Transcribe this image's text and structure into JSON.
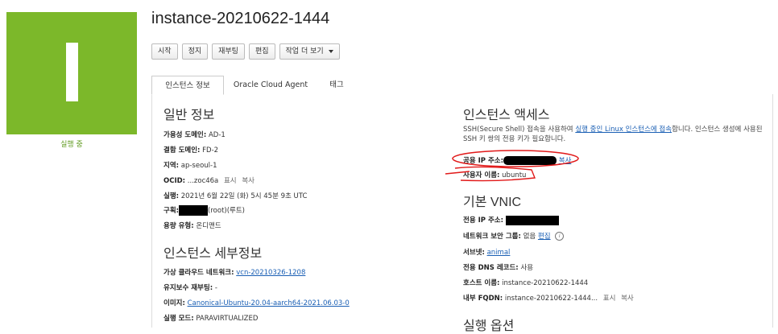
{
  "status": {
    "label": "실행 중"
  },
  "instance": {
    "title": "instance-20210622-1444"
  },
  "actions": {
    "start": "시작",
    "stop": "정지",
    "reboot": "재부팅",
    "edit": "편집",
    "more": "작업 더 보기"
  },
  "tabs": [
    "인스턴스 정보",
    "Oracle Cloud Agent",
    "태그"
  ],
  "general": {
    "heading": "일반 정보",
    "availability_domain": {
      "label": "가용성 도메인:",
      "value": "AD-1"
    },
    "fault_domain": {
      "label": "결함 도메인:",
      "value": "FD-2"
    },
    "region": {
      "label": "지역:",
      "value": "ap-seoul-1"
    },
    "ocid": {
      "label": "OCID:",
      "value": "...zoc46a",
      "show": "표시",
      "copy": "복사"
    },
    "launched": {
      "label": "실행:",
      "value": "2021년 6월 22일 (화) 5시 45분 9초 UTC"
    },
    "compartment": {
      "label": "구획:",
      "value": "(root)(루트)"
    },
    "capacity_type": {
      "label": "용량 유형:",
      "value": "온디맨드"
    }
  },
  "details": {
    "heading": "인스턴스 세부정보",
    "vcn": {
      "label": "가상 클라우드 네트워크:",
      "value": "vcn-20210326-1208"
    },
    "maintenance": {
      "label": "유지보수 재부팅:",
      "value": "-"
    },
    "image": {
      "label": "이미지:",
      "value": "Canonical-Ubuntu-20.04-aarch64-2021.06.03-0"
    },
    "launch_mode": {
      "label": "실행 모드:",
      "value": "PARAVIRTUALIZED"
    }
  },
  "access": {
    "heading": "인스턴스 액세스",
    "desc_before": "SSH(Secure Shell) 접속을 사용하여 ",
    "desc_link": "실행 중인 Linux 인스턴스에 접속",
    "desc_after": "합니다. 인스턴스 생성에 사용된 SSH 키 쌍의 전용 키가 필요합니다.",
    "public_ip": {
      "label": "공용 IP 주소:",
      "copy": "복사"
    },
    "username": {
      "label": "사용자 이름:",
      "value": "ubuntu"
    }
  },
  "vnic": {
    "heading": "기본 VNIC",
    "private_ip": {
      "label": "전용 IP 주소:"
    },
    "nsg": {
      "label": "네트워크 보안 그룹:",
      "value": "없음",
      "edit": "편집",
      "info_icon": "info-icon"
    },
    "subnet": {
      "label": "서브넷:",
      "value": "animal"
    },
    "private_dns": {
      "label": "전용 DNS 레코드:",
      "value": "사용"
    },
    "hostname": {
      "label": "호스트 이름:",
      "value": "instance-20210622-1444"
    },
    "fqdn": {
      "label": "내부 FQDN:",
      "value": "instance-20210622-1444...",
      "show": "표시",
      "copy": "복사"
    }
  },
  "launch_options": {
    "heading": "실행 옵션"
  },
  "colors": {
    "status_green": "#7cb82a",
    "annotation_red": "#e11919",
    "link": "#1a5fb4"
  }
}
